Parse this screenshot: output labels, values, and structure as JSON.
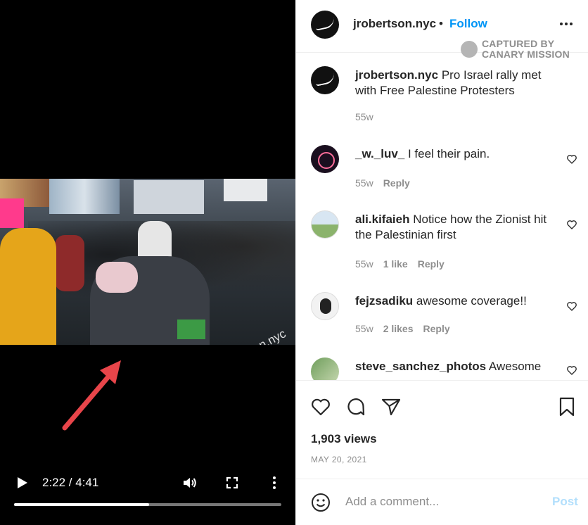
{
  "video": {
    "watermark": "@jrobertson.nyc",
    "time": "2:22 / 4:41",
    "progress": 0.505,
    "icons": [
      "play-icon",
      "volume-icon",
      "fullscreen-icon",
      "more-vertical-icon"
    ]
  },
  "header": {
    "username": "jrobertson.nyc",
    "dot": "•",
    "follow_label": "Follow",
    "more_icon": "more-horizontal-icon"
  },
  "captured": {
    "line1": "CAPTURED BY",
    "line2": "CANARY MISSION"
  },
  "caption": {
    "user": "jrobertson.nyc",
    "text": " Pro Israel rally met with Free Palestine Protesters",
    "time": "55w"
  },
  "comments": [
    {
      "user": "_w._luv_",
      "text": " I feel their pain.",
      "time": "55w",
      "likes": "",
      "reply": "Reply"
    },
    {
      "user": "ali.kifaieh",
      "text": " Notice how the Zionist hit the Palestinian first",
      "time": "55w",
      "likes": "1 like",
      "reply": "Reply"
    },
    {
      "user": "fejzsadiku",
      "text": " awesome coverage!!",
      "time": "55w",
      "likes": "2 likes",
      "reply": "Reply"
    },
    {
      "user": "steve_sanchez_photos",
      "text": " Awesome",
      "time": "",
      "likes": "",
      "reply": ""
    }
  ],
  "actions": {
    "views": "1,903 views",
    "date": "MAY 20, 2021",
    "icons": [
      "like-heart-icon",
      "comment-icon",
      "share-icon",
      "bookmark-icon"
    ]
  },
  "add_comment": {
    "placeholder": "Add a comment...",
    "post_label": "Post"
  },
  "colors": {
    "accent": "#0095f6",
    "post_disabled": "#b2dffc",
    "arrow": "#e8454a"
  }
}
